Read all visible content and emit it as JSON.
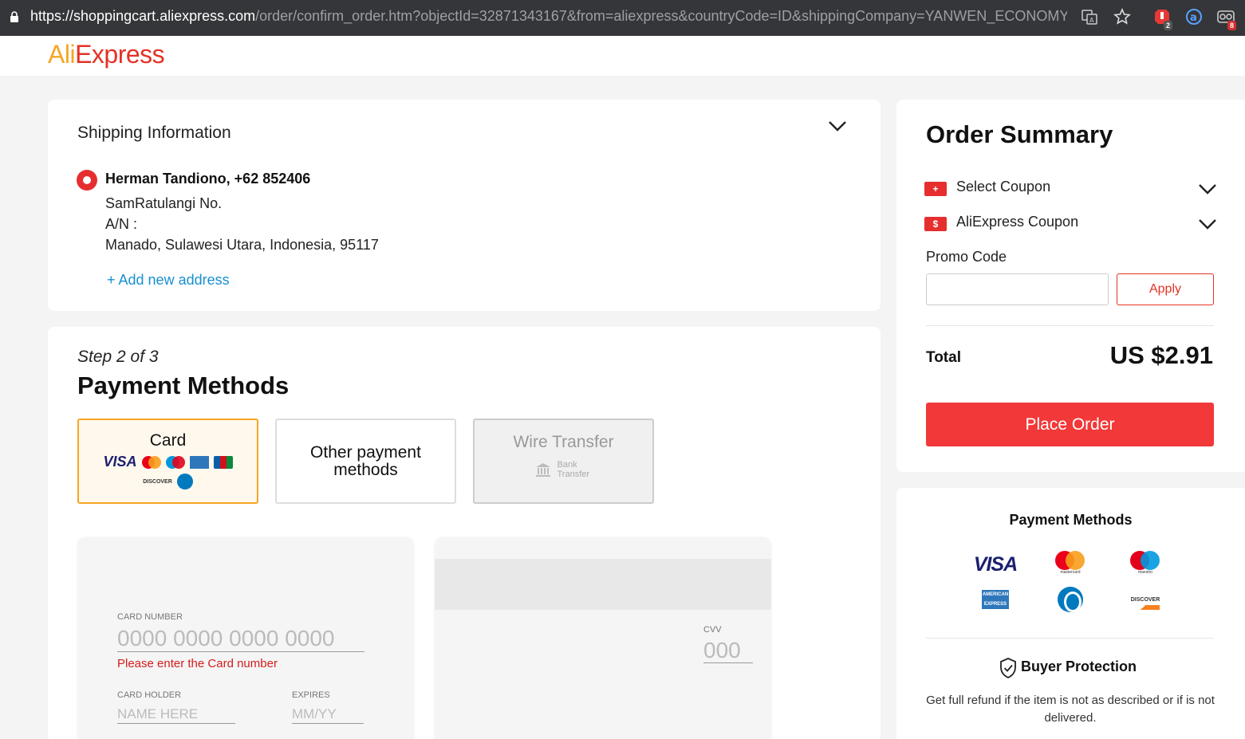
{
  "browser": {
    "url_host": "https://shoppingcart.aliexpress.com",
    "url_path": "/order/confirm_order.htm?objectId=32871343167&from=aliexpress&countryCode=ID&shippingCompany=YANWEN_ECONOMY&...",
    "ext_badge_1": "2",
    "ext_badge_2": "8"
  },
  "header": {
    "logo_ali": "Ali",
    "logo_express": "Express"
  },
  "shipping": {
    "title": "Shipping Information",
    "name": "Herman Tandiono, +62 852406",
    "street": "SamRatulangi No.",
    "an": "A/N :",
    "city": "Manado, Sulawesi Utara, Indonesia, 95117",
    "add_address": "+ Add new address"
  },
  "payment": {
    "step": "Step 2 of 3",
    "title": "Payment Methods",
    "methods": [
      {
        "label": "Card",
        "selected": true
      },
      {
        "label": "Other payment methods",
        "selected": false
      },
      {
        "label": "Wire Transfer",
        "disabled": true
      }
    ],
    "bank_transfer": "Bank Transfer",
    "card_form": {
      "card_number_label": "CARD NUMBER",
      "card_number_placeholder": "0000 0000 0000 0000",
      "card_number_error": "Please enter the Card number",
      "holder_label": "CARD HOLDER",
      "holder_placeholder": "NAME HERE",
      "expires_label": "EXPIRES",
      "expires_placeholder": "MM/YY",
      "cvv_label": "CVV",
      "cvv_placeholder": "000"
    }
  },
  "summary": {
    "title": "Order Summary",
    "select_coupon": "Select Coupon",
    "aliexpress_coupon": "AliExpress Coupon",
    "promo_label": "Promo Code",
    "promo_value": "",
    "apply": "Apply",
    "total_label": "Total",
    "total_value": "US $2.91",
    "place_order": "Place Order"
  },
  "payment_logos": {
    "title": "Payment Methods",
    "visa": "VISA",
    "mastercard": "mastercard",
    "maestro": "maestro",
    "amex": "AMERICAN EXPRESS",
    "discover": "DISCOVER"
  },
  "protection": {
    "title": "Buyer Protection",
    "text": "Get full refund if the item is not as described or if is not delivered."
  },
  "colors": {
    "accent": "#e43225",
    "button": "#f23838",
    "selected_border": "#f5a623",
    "link": "#1890d0"
  }
}
